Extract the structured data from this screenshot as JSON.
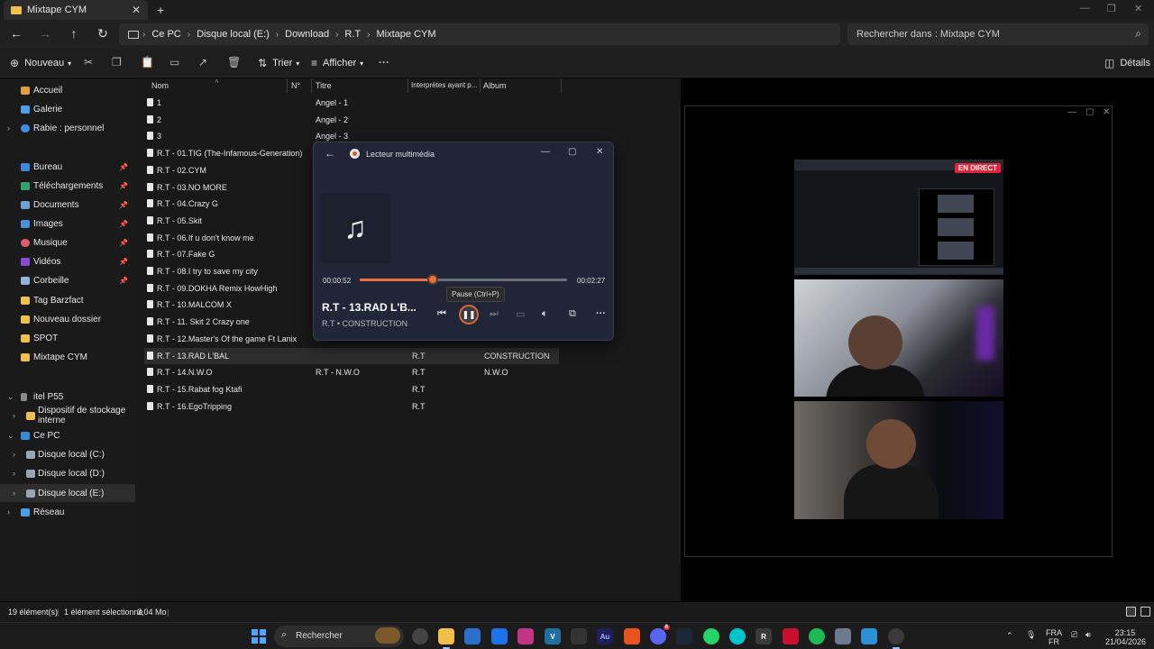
{
  "window": {
    "tab_title": "Mixtape CYM"
  },
  "address": {
    "crumbs": [
      "Ce PC",
      "Disque local (E:)",
      "Download",
      "R.T",
      "Mixtape CYM"
    ],
    "search_placeholder": "Rechercher dans : Mixtape CYM"
  },
  "toolbar": {
    "new_label": "Nouveau",
    "sort_label": "Trier",
    "view_label": "Afficher",
    "details_label": "Détails"
  },
  "nav": {
    "home": "Accueil",
    "gallery": "Galerie",
    "onedrive": "Rabie : personnel",
    "desktop": "Bureau",
    "downloads": "Téléchargements",
    "documents": "Documents",
    "pictures": "Images",
    "music": "Musique",
    "videos": "Vidéos",
    "recycle": "Corbeille",
    "tag": "Tag Barzfact",
    "newfolder": "Nouveau dossier",
    "spot": "SPOT",
    "mixtape": "Mixtape CYM",
    "phone": "itel P55",
    "storage": "Dispositif de stockage interne",
    "thispc": "Ce PC",
    "disk_c": "Disque local (C:)",
    "disk_d": "Disque local (D:)",
    "disk_e": "Disque local (E:)",
    "network": "Réseau"
  },
  "columns": {
    "name": "Nom",
    "number": "N°",
    "title": "Titre",
    "artists": "Interprètes ayant p...",
    "album": "Album"
  },
  "files": [
    {
      "name": "1",
      "title": "Angel - 1",
      "artist": "",
      "album": ""
    },
    {
      "name": "2",
      "title": "Angel - 2",
      "artist": "",
      "album": ""
    },
    {
      "name": "3",
      "title": "Angel - 3",
      "artist": "",
      "album": ""
    },
    {
      "name": "R.T - 01.TIG (The-Infamous-Generation)",
      "title": "",
      "artist": "",
      "album": ""
    },
    {
      "name": "R.T - 02.CYM",
      "title": "",
      "artist": "",
      "album": ""
    },
    {
      "name": "R.T - 03.NO MORE",
      "title": "",
      "artist": "",
      "album": ""
    },
    {
      "name": "R.T - 04.Crazy G",
      "title": "",
      "artist": "",
      "album": ""
    },
    {
      "name": "R.T - 05.Skit",
      "title": "",
      "artist": "",
      "album": ""
    },
    {
      "name": "R.T - 06.If u don't know me",
      "title": "",
      "artist": "",
      "album": ""
    },
    {
      "name": "R.T - 07.Fake G",
      "title": "",
      "artist": "",
      "album": ""
    },
    {
      "name": "R.T - 08.I try to save my city",
      "title": "",
      "artist": "",
      "album": ""
    },
    {
      "name": "R.T - 09.DOKHA Remix HowHigh",
      "title": "",
      "artist": "",
      "album": ""
    },
    {
      "name": "R.T - 10.MALCOM X",
      "title": "",
      "artist": "",
      "album": ""
    },
    {
      "name": "R.T - 11. Skit 2 Crazy one",
      "title": "",
      "artist": "",
      "album": ""
    },
    {
      "name": "R.T - 12.Master's Of the game Ft Lanix",
      "title": "",
      "artist": "",
      "album": ""
    },
    {
      "name": "R.T - 13.RAD L'BAL",
      "title": "",
      "artist": "R.T",
      "album": "CONSTRUCTION"
    },
    {
      "name": "R.T - 14.N.W.O",
      "title": "R.T - N.W.O",
      "artist": "R.T",
      "album": "N.W.O"
    },
    {
      "name": "R.T - 15.Rabat fog Ktafi",
      "title": "",
      "artist": "R.T",
      "album": ""
    },
    {
      "name": "R.T - 16.EgoTripping",
      "title": "",
      "artist": "R.T",
      "album": ""
    }
  ],
  "player": {
    "window_title": "Lecteur multimédia",
    "current_time": "00:00:52",
    "total_time": "00:02:27",
    "progress": 0.354,
    "tooltip": "Pause (Ctrl+P)",
    "song_title": "R.T - 13.RAD L'B...",
    "song_subtitle": "R.T • CONSTRUCTION"
  },
  "stream": {
    "live_badge": "EN DIRECT"
  },
  "status": {
    "count": "19 élément(s)",
    "selected": "1 élément sélectionné",
    "size": "3,04 Mo"
  },
  "taskbar": {
    "search_label": "Rechercher",
    "lang_top": "FRA",
    "lang_bottom": "FR",
    "time": "23:15",
    "date": "21/04/2026",
    "notif_badge": "6"
  },
  "colors": {
    "accent": "#e8733a",
    "live": "#e5243b",
    "folder": "#f0c04a"
  }
}
